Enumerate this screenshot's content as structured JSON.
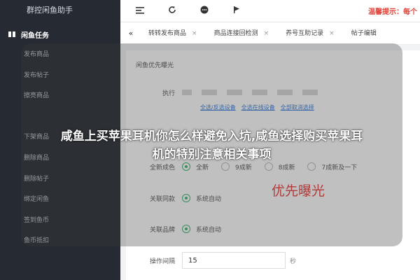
{
  "app": {
    "title": "群控闲鱼助手"
  },
  "sidebar": {
    "section": {
      "icon": "idle-fish-icon",
      "label": "闲鱼任务"
    },
    "items": [
      {
        "label": "发布商品"
      },
      {
        "label": "发布帖子"
      },
      {
        "label": "擦亮商品"
      },
      {
        "label": ""
      },
      {
        "label": "下架商品"
      },
      {
        "label": "删除商品"
      },
      {
        "label": "删除帖子"
      },
      {
        "label": "绑定闲鱼"
      },
      {
        "label": "签到鱼币"
      },
      {
        "label": "鱼币抵扣"
      }
    ]
  },
  "toolbar": {
    "icons": [
      "menu-icon",
      "refresh-icon",
      "chat-icon",
      "flag-icon"
    ],
    "warning": "温馨提示：每个"
  },
  "tabs": {
    "prev_icon": "double-chevron-left-icon",
    "items": [
      {
        "label": "转转发布商品"
      },
      {
        "label": "商品连接回检测"
      },
      {
        "label": "养号互助记录"
      },
      {
        "label": "帖子编辑"
      }
    ]
  },
  "panel": {
    "title": "闲鱼优先曝光",
    "execute_label": "执行",
    "links": [
      "全选/反选设备",
      "全选在线设备",
      "全部取消选择"
    ],
    "condition_label": "全新成色",
    "condition_options": [
      {
        "label": "全新",
        "selected": true
      },
      {
        "label": "9成新",
        "selected": false
      },
      {
        "label": "8成新",
        "selected": false
      },
      {
        "label": "7成新及一下",
        "selected": false
      }
    ],
    "related_keyword": {
      "label": "关联同款",
      "option": "系统自动"
    },
    "related_brand": {
      "label": "关联品牌",
      "option": "系统自动"
    },
    "interval": {
      "label": "操作间隔",
      "value": "15",
      "unit": "秒"
    },
    "promo": "优先曝光"
  },
  "overlay": {
    "line1": "咸鱼上买苹果耳机你怎么样避免入坑,咸鱼选择购买苹果耳",
    "line2": "机的特别注意相关事项"
  },
  "colors": {
    "sidebar_bg": "#262b33",
    "accent_green": "#3cb371",
    "link_blue": "#3a7bd5",
    "warning_red": "#e0453b"
  }
}
